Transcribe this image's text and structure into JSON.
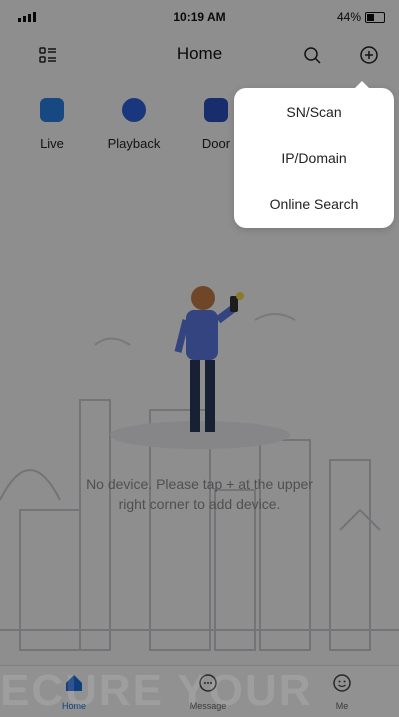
{
  "status_bar": {
    "time": "10:19 AM",
    "battery": "44%"
  },
  "header": {
    "title": "Home",
    "menu_icon": "list-menu-icon",
    "search_icon": "search-icon",
    "add_icon": "add-circle-icon"
  },
  "shortcuts": [
    {
      "label": "Live",
      "icon": "camera-icon",
      "color": "#2a7de1"
    },
    {
      "label": "Playback",
      "icon": "playback-icon",
      "color": "#2a5fd8"
    },
    {
      "label": "Door",
      "icon": "door-icon",
      "color": "#2a4fb8"
    }
  ],
  "empty_state": {
    "line1": "No device. Please tap + at the upper",
    "line2": "right corner to add device."
  },
  "add_menu": {
    "items": [
      "SN/Scan",
      "IP/Domain",
      "Online Search"
    ]
  },
  "tabbar": {
    "tabs": [
      {
        "label": "Home",
        "icon": "home-icon"
      },
      {
        "label": "Message",
        "icon": "message-icon"
      },
      {
        "label": "Me",
        "icon": "me-icon"
      }
    ]
  },
  "watermark": "ECURE YOUR",
  "colors": {
    "accent": "#1d6ad8",
    "overlay": "rgba(0,0,0,0.42)"
  }
}
